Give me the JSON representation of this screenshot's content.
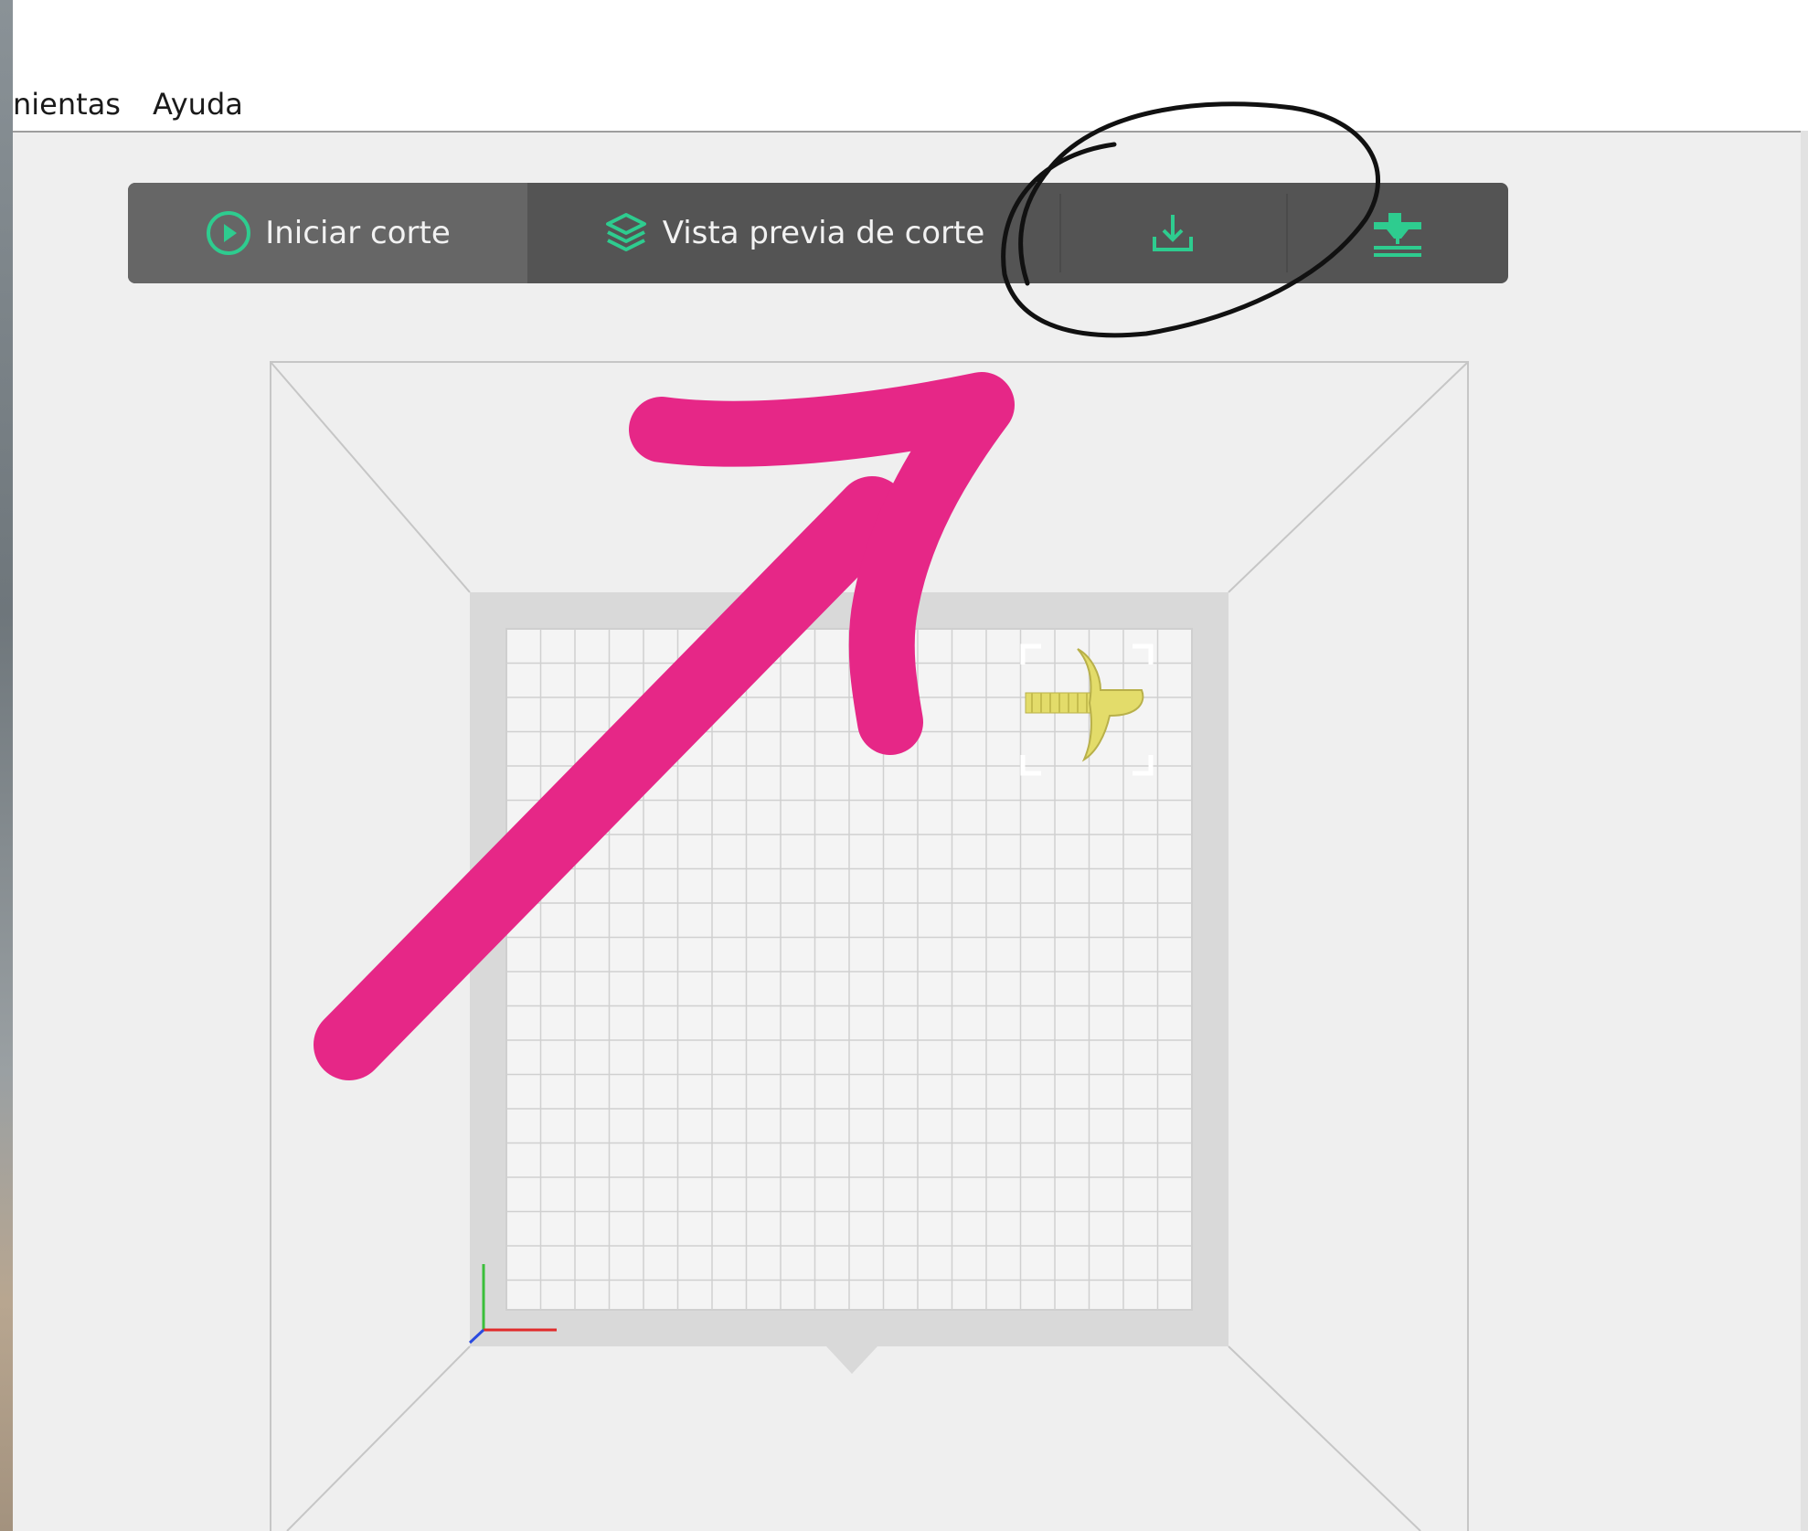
{
  "menu": {
    "items": [
      {
        "label": "nientas"
      },
      {
        "label": "Ayuda"
      }
    ]
  },
  "toolbar": {
    "slice_label": "Iniciar corte",
    "preview_label": "Vista previa de corte",
    "export_icon": "download-icon",
    "device_icon": "printer-nozzle-icon"
  },
  "colors": {
    "accent": "#2ecc8f",
    "toolbar_bg": "#545454",
    "toolbar_active_bg": "#666666",
    "canvas_bg": "#efefef",
    "bed_plate": "#d9d9d9",
    "model": "#e3dc6a",
    "annotation_arrow": "#e62787",
    "annotation_circle": "#111111"
  },
  "scene": {
    "model_name": "3d-model",
    "axis_indicator": "xyz-axes"
  }
}
